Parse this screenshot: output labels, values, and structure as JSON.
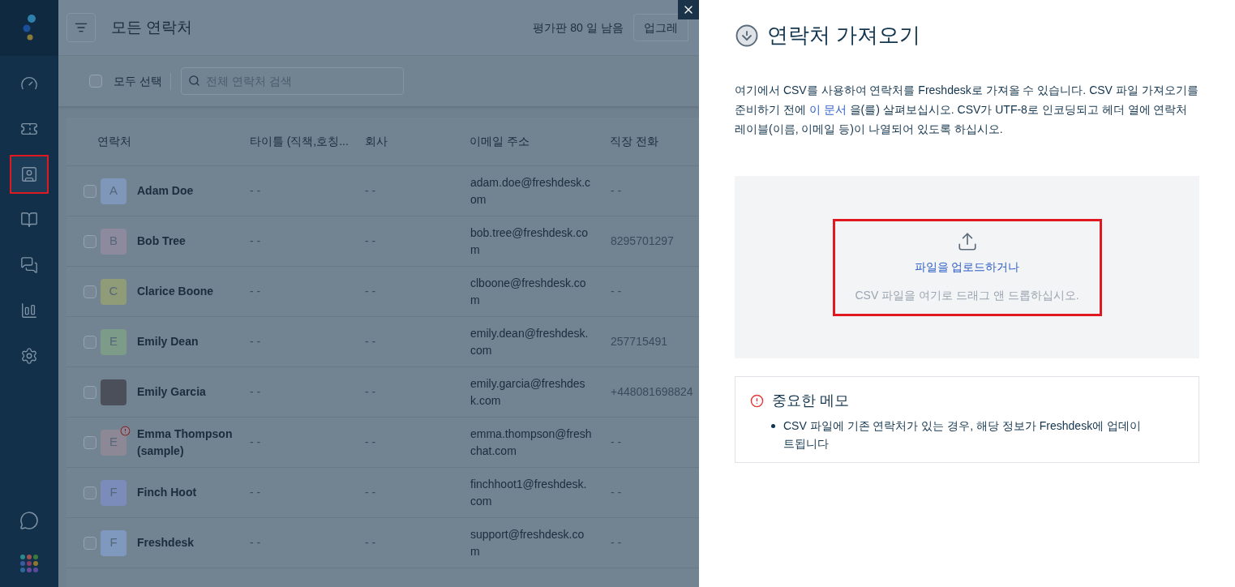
{
  "sidebar": {
    "items": [
      {
        "selected": false
      },
      {
        "selected": false
      },
      {
        "selected": true
      },
      {
        "selected": false
      },
      {
        "selected": false
      },
      {
        "selected": false
      },
      {
        "selected": false
      }
    ]
  },
  "header": {
    "title": "모든 연락처",
    "trial": "평가판 80 일 남음",
    "upgrade_button": "업그레"
  },
  "toolbar": {
    "select_all": {
      "label": "모두 선택",
      "checked": false
    },
    "search": {
      "placeholder": "전체 연락처 검색"
    }
  },
  "table": {
    "columns": [
      "연락처",
      "타이틀 (직책,호칭...",
      "회사",
      "이메일 주소",
      "직장 전화"
    ],
    "rows": [
      {
        "checked": false,
        "initial": "A",
        "color": "#7f97b8",
        "photo": false,
        "alert": false,
        "name": "Adam Doe",
        "title": "- -",
        "company": "- -",
        "email": "adam.doe@freshdesk.com",
        "phone": "- -"
      },
      {
        "checked": false,
        "initial": "B",
        "color": "#8d8a9e",
        "photo": false,
        "alert": false,
        "name": "Bob Tree",
        "title": "- -",
        "company": "- -",
        "email": "bob.tree@freshdesk.com",
        "phone": "8295701297"
      },
      {
        "checked": false,
        "initial": "C",
        "color": "#909b78",
        "photo": false,
        "alert": false,
        "name": "Clarice Boone",
        "title": "- -",
        "company": "- -",
        "email": "clboone@freshdesk.com",
        "phone": "- -"
      },
      {
        "checked": false,
        "initial": "E",
        "color": "#7c9b88",
        "photo": false,
        "alert": false,
        "name": "Emily Dean",
        "title": "- -",
        "company": "- -",
        "email": "emily.dean@freshdesk.com",
        "phone": "257715491"
      },
      {
        "checked": false,
        "photo": true,
        "alert": false,
        "name": "Emily Garcia",
        "title": "- -",
        "company": "- -",
        "email": "emily.garcia@freshdesk.com",
        "phone": "+448081698824"
      },
      {
        "checked": false,
        "initial": "E",
        "color": "#8d8896",
        "photo": false,
        "alert": true,
        "name": "Emma Thompson (sample)",
        "title": "- -",
        "company": "- -",
        "email": "emma.thompson@freshchat.com",
        "phone": "- -"
      },
      {
        "checked": false,
        "initial": "F",
        "color": "#7b8cba",
        "photo": false,
        "alert": false,
        "name": "Finch Hoot",
        "title": "- -",
        "company": "- -",
        "email": "finchhoot1@freshdesk.com",
        "phone": "- -"
      },
      {
        "checked": false,
        "initial": "F",
        "color": "#7f98bd",
        "photo": false,
        "alert": false,
        "name": "Freshdesk",
        "title": "- -",
        "company": "- -",
        "email": "support@freshdesk.com",
        "phone": "- -"
      }
    ]
  },
  "import_panel": {
    "title": "연락처 가져오기",
    "description": {
      "before": "여기에서 CSV를 사용하여 연락처를 Freshdesk로 가져올 수 있습니다. CSV 파일 가져오기를 준비하기 전에 ",
      "link": "이 문서",
      "after": " 을(를) 살펴보십시오. CSV가 UTF-8로 인코딩되고 헤더 열에 연락처 레이블(이름, 이메일 등)이 나열되어 있도록 하십시오."
    },
    "upload": {
      "link": "파일을 업로드하거나",
      "hint": "CSV 파일을 여기로 드래그 앤 드롭하십시오."
    },
    "note": {
      "title": "중요한 메모",
      "bullets": [
        "CSV 파일에 기존 연락처가 있는 경우, 해당 정보가 Freshdesk에 업데이트됩니다"
      ]
    }
  }
}
